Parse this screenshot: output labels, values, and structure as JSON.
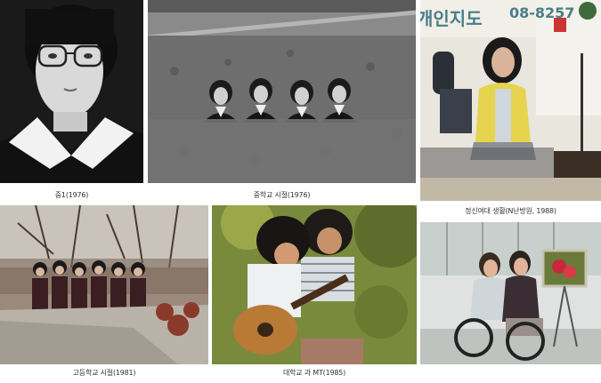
{
  "captions": {
    "c1": "중1(1976)",
    "c2": "중학교 시절(1976)",
    "c3": "정신여대 생활(N난방원, 1988)",
    "c4": "고등학교 시절(1981)",
    "c5": "대학교 과 MT(1985)"
  },
  "signs": {
    "phone": "08-8257",
    "office": "개인지도"
  }
}
